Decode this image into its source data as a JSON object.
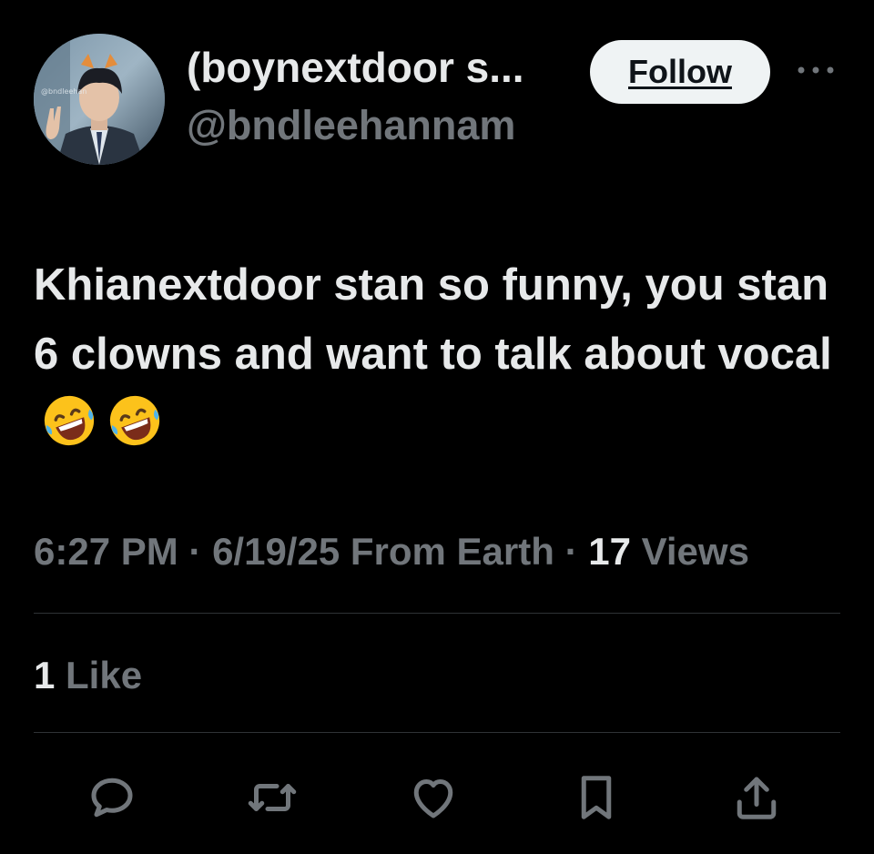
{
  "author": {
    "display_name": "(boynextdoor s...",
    "handle": "@bndleehannam",
    "avatar_watermark": "@bndleehan"
  },
  "header": {
    "follow_label": "Follow",
    "more_icon": "more-horizontal-icon"
  },
  "tweet": {
    "text": "Khianextdoor stan so funny, you stan 6 clowns and want to talk about vocal",
    "emojis": [
      "rolling-on-floor-laughing-emoji",
      "rolling-on-floor-laughing-emoji"
    ]
  },
  "meta": {
    "time": "6:27 PM",
    "separator": " · ",
    "date": "6/19/25",
    "location": "From Earth",
    "views_count": "17",
    "views_label": "Views"
  },
  "engagement": {
    "likes_count": "1",
    "likes_label": "Like"
  },
  "actions": [
    {
      "icon": "reply-icon"
    },
    {
      "icon": "retweet-icon"
    },
    {
      "icon": "like-heart-icon"
    },
    {
      "icon": "bookmark-icon"
    },
    {
      "icon": "share-icon"
    }
  ],
  "colors": {
    "background": "#000000",
    "primary_text": "#e7e9ea",
    "secondary_text": "#71767b",
    "divider": "#2f3336",
    "follow_button_bg": "#eff3f4",
    "follow_button_text": "#0f1419"
  }
}
